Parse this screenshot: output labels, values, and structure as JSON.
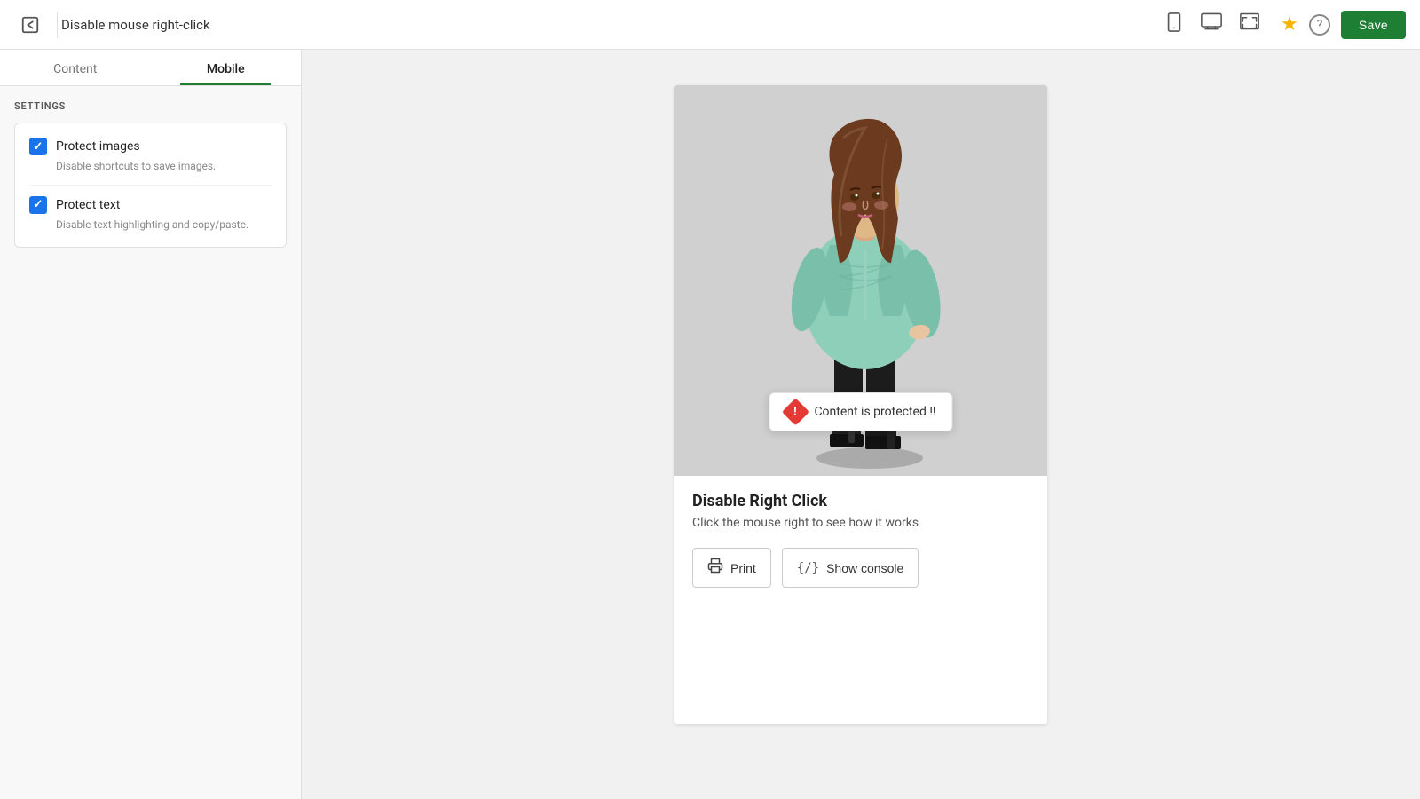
{
  "header": {
    "title": "Disable mouse right-click",
    "save_label": "Save",
    "back_icon": "←",
    "star_icon": "★",
    "help_icon": "?",
    "device_icons": [
      {
        "name": "mobile",
        "symbol": "📱",
        "active": false
      },
      {
        "name": "desktop",
        "symbol": "🖥",
        "active": false
      },
      {
        "name": "fullscreen",
        "symbol": "⛶",
        "active": false
      }
    ]
  },
  "tabs": [
    {
      "label": "Content",
      "active": false
    },
    {
      "label": "Mobile",
      "active": true
    }
  ],
  "settings": {
    "section_label": "SETTINGS",
    "items": [
      {
        "name": "protect_images",
        "label": "Protect images",
        "description": "Disable shortcuts to save images.",
        "checked": true
      },
      {
        "name": "protect_text",
        "label": "Protect text",
        "description": "Disable text highlighting and copy/paste.",
        "checked": true
      }
    ]
  },
  "preview": {
    "toast": {
      "text": "Content is protected !!"
    },
    "heading": "Disable Right Click",
    "subtext": "Click the mouse right to see how it works",
    "buttons": [
      {
        "label": "Print",
        "icon": "🖨"
      },
      {
        "label": "Show console",
        "icon": "{/}"
      }
    ]
  },
  "colors": {
    "accent_green": "#1e7e34",
    "accent_blue": "#1a73e8",
    "tab_active_underline": "#1e7e34",
    "toast_icon_bg": "#e53935",
    "star": "#f4b400"
  }
}
